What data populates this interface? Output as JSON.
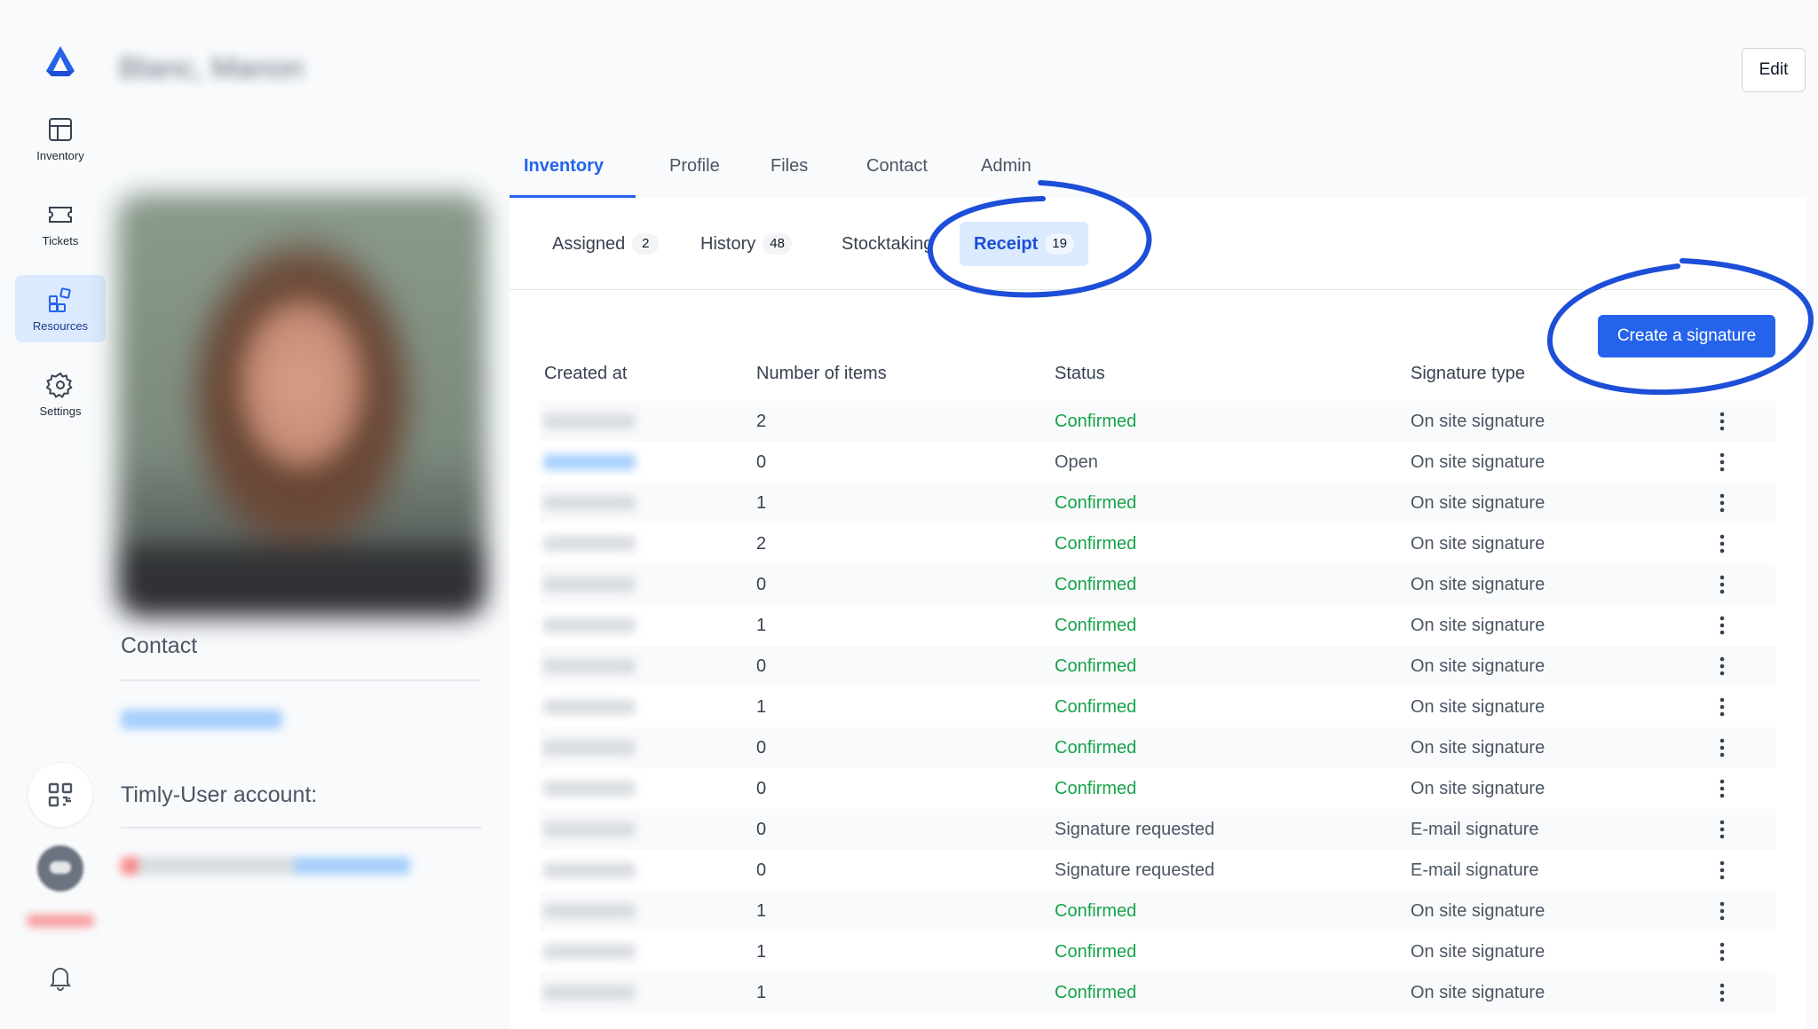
{
  "sidebar": {
    "items": [
      {
        "label": "Inventory",
        "icon": "inventory-icon"
      },
      {
        "label": "Tickets",
        "icon": "ticket-icon"
      },
      {
        "label": "Resources",
        "icon": "resources-icon",
        "active": true
      },
      {
        "label": "Settings",
        "icon": "gear-icon"
      }
    ]
  },
  "header": {
    "user_name": "Blanc, Manon",
    "edit_label": "Edit"
  },
  "profile": {
    "contact_title": "Contact",
    "account_title": "Timly-User account:"
  },
  "tabs": [
    {
      "label": "Inventory",
      "active": true
    },
    {
      "label": "Profile"
    },
    {
      "label": "Files"
    },
    {
      "label": "Contact"
    },
    {
      "label": "Admin"
    }
  ],
  "subtabs": [
    {
      "label": "Assigned",
      "count": "2"
    },
    {
      "label": "History",
      "count": "48"
    },
    {
      "label": "Stocktaking",
      "count": ""
    },
    {
      "label": "Receipt",
      "count": "19",
      "active": true
    }
  ],
  "create_button": "Create a signature",
  "table": {
    "columns": [
      "Created at",
      "Number of items",
      "Status",
      "Signature type"
    ],
    "rows": [
      {
        "items": "2",
        "status": "Confirmed",
        "type": "On site signature"
      },
      {
        "items": "0",
        "status": "Open",
        "type": "On site signature"
      },
      {
        "items": "1",
        "status": "Confirmed",
        "type": "On site signature"
      },
      {
        "items": "2",
        "status": "Confirmed",
        "type": "On site signature"
      },
      {
        "items": "0",
        "status": "Confirmed",
        "type": "On site signature"
      },
      {
        "items": "1",
        "status": "Confirmed",
        "type": "On site signature"
      },
      {
        "items": "0",
        "status": "Confirmed",
        "type": "On site signature"
      },
      {
        "items": "1",
        "status": "Confirmed",
        "type": "On site signature"
      },
      {
        "items": "0",
        "status": "Confirmed",
        "type": "On site signature"
      },
      {
        "items": "0",
        "status": "Confirmed",
        "type": "On site signature"
      },
      {
        "items": "0",
        "status": "Signature requested",
        "type": "E-mail signature"
      },
      {
        "items": "0",
        "status": "Signature requested",
        "type": "E-mail signature"
      },
      {
        "items": "1",
        "status": "Confirmed",
        "type": "On site signature"
      },
      {
        "items": "1",
        "status": "Confirmed",
        "type": "On site signature"
      },
      {
        "items": "1",
        "status": "Confirmed",
        "type": "On site signature"
      }
    ]
  },
  "colors": {
    "accent": "#2563eb",
    "confirmed": "#16a34a",
    "annotation": "#1d4ed8"
  }
}
